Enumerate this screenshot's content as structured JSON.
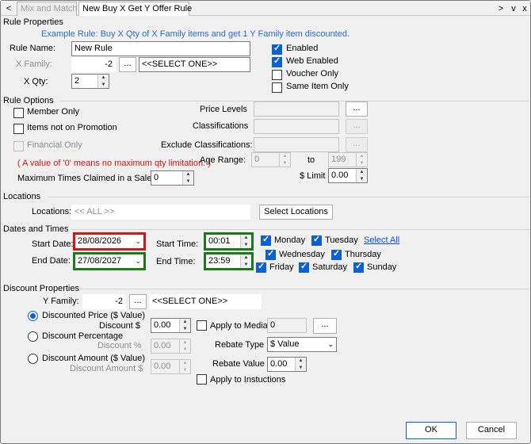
{
  "tabs": [
    {
      "label": "Mix and Match",
      "active": false
    },
    {
      "label": "New Buy X Get Y Offer Rule",
      "active": true
    }
  ],
  "tabbar": {
    "scroll_left": "<",
    "scroll_right": ">",
    "menu": "v",
    "close": "x"
  },
  "rule_properties": {
    "header": "Rule Properties",
    "example": "Example Rule: Buy X Qty of X Family items and get 1 Y Family item discounted.",
    "rule_name_label": "Rule Name:",
    "rule_name_value": "New Rule",
    "x_family_label": "X Family:",
    "x_family_value": "-2",
    "x_family_browse": "...",
    "x_family_select": "<<SELECT ONE>>",
    "x_qty_label": "X Qty:",
    "x_qty_value": "2",
    "enabled_label": "Enabled",
    "web_enabled_label": "Web Enabled",
    "voucher_only_label": "Voucher Only",
    "same_item_only_label": "Same Item Only",
    "enabled": true,
    "web_enabled": true,
    "voucher_only": false,
    "same_item_only": false
  },
  "rule_options": {
    "header": "Rule Options",
    "member_only_label": "Member Only",
    "items_not_on_promotion_label": "Items not on Promotion",
    "financial_only_label": "Financial Only",
    "price_levels_label": "Price Levels",
    "classifications_label": "Classifications",
    "exclude_classifications_label": "Exclude Classifications:",
    "browse": "...",
    "note": "( A value of '0' means no maximum qty limitation. )",
    "age_range_label": "Age Range:",
    "age_from": "0",
    "age_to_label": "to",
    "age_to": "199",
    "max_times_label": "Maximum Times Claimed in a Sale:",
    "max_times_value": "0",
    "limit_label": "$ Limit",
    "limit_value": "0.00"
  },
  "locations": {
    "header": "Locations",
    "label": "Locations:",
    "value": "<< ALL >>",
    "select_button": "Select Locations"
  },
  "dates_times": {
    "header": "Dates and Times",
    "start_date_label": "Start Date:",
    "start_date": "28/08/2026",
    "end_date_label": "End Date:",
    "end_date": "27/08/2027",
    "start_time_label": "Start Time:",
    "start_time": "00:01",
    "end_time_label": "End Time:",
    "end_time": "23:59",
    "days": {
      "monday": "Monday",
      "tuesday": "Tuesday",
      "wednesday": "Wednesday",
      "thursday": "Thursday",
      "friday": "Friday",
      "saturday": "Saturday",
      "sunday": "Sunday"
    },
    "select_all": "Select All"
  },
  "discount": {
    "header": "Discount Properties",
    "y_family_label": "Y Family:",
    "y_family_value": "-2",
    "y_family_browse": "...",
    "y_family_select": "<<SELECT ONE>>",
    "discounted_price_label": "Discounted Price ($ Value)",
    "discount_dollar_label": "Discount $",
    "discount_dollar_value": "0.00",
    "discount_percentage_label": "Discount Percentage",
    "discount_percent_label": "Discount %",
    "discount_percent_value": "0.00",
    "discount_amount_label": "Discount Amount ($ Value)",
    "discount_amount_field_label": "Discount Amount $",
    "discount_amount_value": "0.00",
    "apply_to_media_label": "Apply to Media:",
    "apply_to_media_value": "0",
    "media_browse": "...",
    "rebate_type_label": "Rebate Type",
    "rebate_type_value": "$ Value",
    "rebate_value_label": "Rebate Value",
    "rebate_value": "0.00",
    "apply_to_instructions_label": "Apply to Instuctions"
  },
  "footer": {
    "ok": "OK",
    "cancel": "Cancel"
  },
  "colors": {
    "accent": "#0b5fd7",
    "required": "#e20f0f",
    "valid": "#1a7a1a",
    "link": "#0645ff"
  }
}
